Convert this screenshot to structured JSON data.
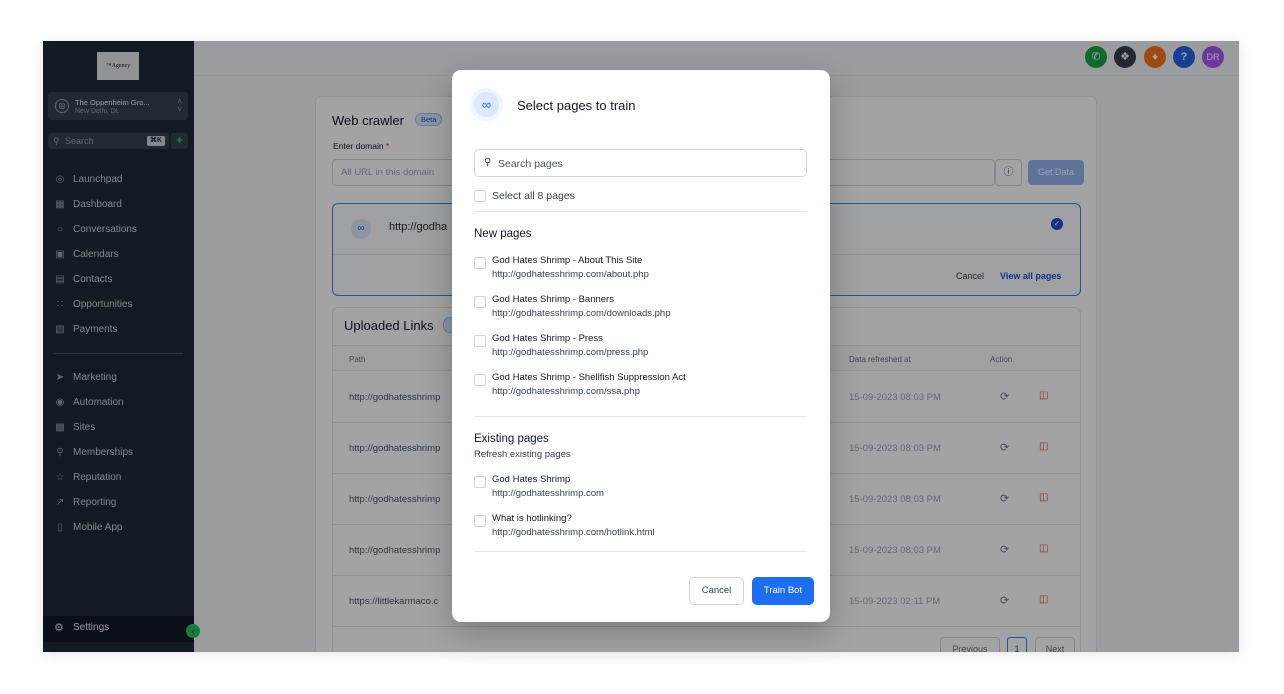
{
  "sidebar": {
    "logo_text": "™Agency",
    "account": {
      "name": "The Oppenheim Gro...",
      "location": "New Delhi, DL"
    },
    "search": {
      "placeholder": "Search",
      "shortcut": "⌘K"
    },
    "nav_top": [
      {
        "label": "Launchpad",
        "icon": "rocket-icon"
      },
      {
        "label": "Dashboard",
        "icon": "grid-icon"
      },
      {
        "label": "Conversations",
        "icon": "chat-icon"
      },
      {
        "label": "Calendars",
        "icon": "calendar-icon"
      },
      {
        "label": "Contacts",
        "icon": "contacts-icon"
      },
      {
        "label": "Opportunities",
        "icon": "opportunities-icon"
      },
      {
        "label": "Payments",
        "icon": "payments-icon"
      }
    ],
    "nav_bottom": [
      {
        "label": "Marketing",
        "icon": "send-icon"
      },
      {
        "label": "Automation",
        "icon": "automation-icon"
      },
      {
        "label": "Sites",
        "icon": "sites-icon"
      },
      {
        "label": "Memberships",
        "icon": "memberships-icon"
      },
      {
        "label": "Reputation",
        "icon": "star-icon"
      },
      {
        "label": "Reporting",
        "icon": "trend-icon"
      },
      {
        "label": "Mobile App",
        "icon": "mobile-icon"
      }
    ],
    "settings_label": "Settings"
  },
  "topbar": {
    "avatar_initials": "DR",
    "colors": {
      "phone": "#16a34a",
      "megaphone": "#374151",
      "bell": "#f97316",
      "help": "#2563eb",
      "avatar": "#a855f7"
    }
  },
  "web_crawler": {
    "title": "Web crawler",
    "beta_label": "Beta",
    "enter_domain_label": "Enter domain",
    "required_mark": "*",
    "url_placeholder": "All URL in this domain",
    "get_data_label": "Get Data",
    "result_url": "http://godha",
    "cancel_label": "Cancel",
    "view_all_label": "View all pages"
  },
  "uploaded_links": {
    "title": "Uploaded Links",
    "columns": {
      "path": "Path",
      "refreshed": "Data refreshed at",
      "action": "Action"
    },
    "rows": [
      {
        "path": "http://godhatesshrimp",
        "date": "15-09-2023 08:03 PM"
      },
      {
        "path": "http://godhatesshrimp",
        "date": "15-09-2023 08:03 PM"
      },
      {
        "path": "http://godhatesshrimp",
        "date": "15-09-2023 08:03 PM"
      },
      {
        "path": "http://godhatesshrimp",
        "date": "15-09-2023 08:03 PM"
      },
      {
        "path": "https://littlekarmaco.c",
        "date": "15-09-2023 02:11 PM"
      }
    ],
    "pagination": {
      "previous": "Previous",
      "current_page": "1",
      "next": "Next"
    }
  },
  "modal": {
    "title": "Select pages to train",
    "search_placeholder": "Search pages",
    "select_all_label": "Select all 8 pages",
    "new_pages_heading": "New pages",
    "new_pages": [
      {
        "title": "God Hates Shrimp - About This Site",
        "url": "http://godhatesshrimp.com/about.php"
      },
      {
        "title": "God Hates Shrimp - Banners",
        "url": "http://godhatesshrimp.com/downloads.php"
      },
      {
        "title": "God Hates Shrimp - Press",
        "url": "http://godhatesshrimp.com/press.php"
      },
      {
        "title": "God Hates Shrimp - Shellfish Suppression Act",
        "url": "http://godhatesshrimp.com/ssa.php"
      }
    ],
    "existing_pages_heading": "Existing pages",
    "existing_pages_sub": "Refresh existing pages",
    "existing_pages": [
      {
        "title": "God Hates Shrimp",
        "url": "http://godhatesshrimp.com"
      },
      {
        "title": "What is hotlinking?",
        "url": "http://godhatesshrimp.com/hotlink.html"
      }
    ],
    "cancel_label": "Cancel",
    "train_label": "Train Bot",
    "accent_color": "#1d6ef0"
  }
}
